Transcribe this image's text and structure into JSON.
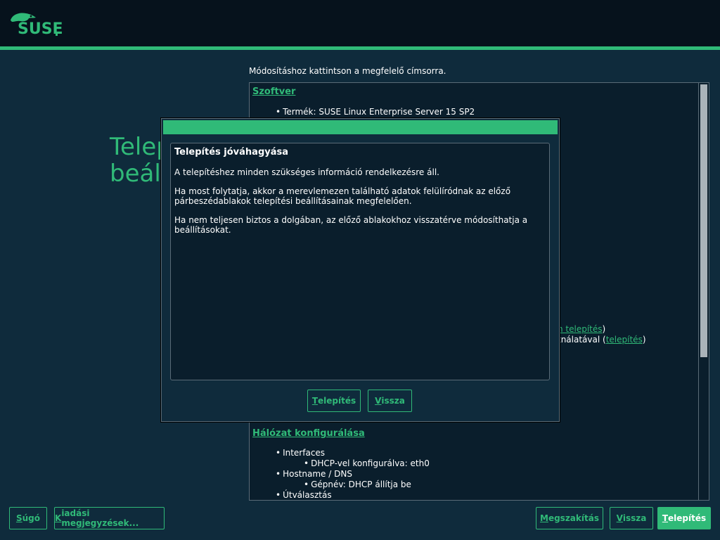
{
  "brand": {
    "logo_text": "SUSE"
  },
  "page": {
    "title_line1": "Telep",
    "title_line2": "beáll",
    "hint": "Módosításhoz kattintson a megfelelő címsorra."
  },
  "summary": {
    "software": {
      "title": "Szoftver",
      "product": "Termék: SUSE Linux Enterprise Server 15 SP2"
    },
    "hidden_fragment_1_tail": ")",
    "hidden_fragment_1_link": "n telepítés",
    "hidden_fragment_2_text": "tnálatával (",
    "hidden_fragment_2_link": "telepítés",
    "hidden_fragment_2_tail": ")",
    "network": {
      "title": "Hálózat konfigurálása",
      "items": [
        {
          "label": "Interfaces",
          "level": 1
        },
        {
          "label": "DHCP-vel konfigurálva: eth0",
          "level": 2
        },
        {
          "label": "Hostname / DNS",
          "level": 1
        },
        {
          "label": "Gépnév: DHCP állítja be",
          "level": 2
        },
        {
          "label": "Útválasztás",
          "level": 1
        }
      ]
    }
  },
  "dialog": {
    "heading": "Telepítés jóváhagyása",
    "p1": "A telepítéshez minden szükséges információ rendelkezésre áll.",
    "p2": "Ha most folytatja, akkor a merevlemezen található adatok felülíródnak az előző párbeszédablakok telepítési beállításainak megfelelően.",
    "p3": "Ha nem teljesen biztos a dolgában, az előző ablakokhoz visszatérve módosíthatja a beállításokat.",
    "install_button": {
      "accel": "T",
      "rest": "elepítés"
    },
    "back_button": {
      "accel": "V",
      "rest": "issza"
    }
  },
  "footer": {
    "help_button": {
      "accel": "S",
      "rest": "úgó"
    },
    "release_notes_button": {
      "accel": "K",
      "rest": "iadási megjegyzések..."
    },
    "abort_button": {
      "accel": "M",
      "rest": "egszakítás"
    },
    "back_button": {
      "accel": "V",
      "rest": "issza"
    },
    "install_button": {
      "accel": "T",
      "rest": "elepítés"
    }
  },
  "colors": {
    "accent": "#30ba78",
    "background": "#0f2b3c",
    "header": "#06121c"
  },
  "icons": {
    "logo": "suse-chameleon-icon"
  }
}
